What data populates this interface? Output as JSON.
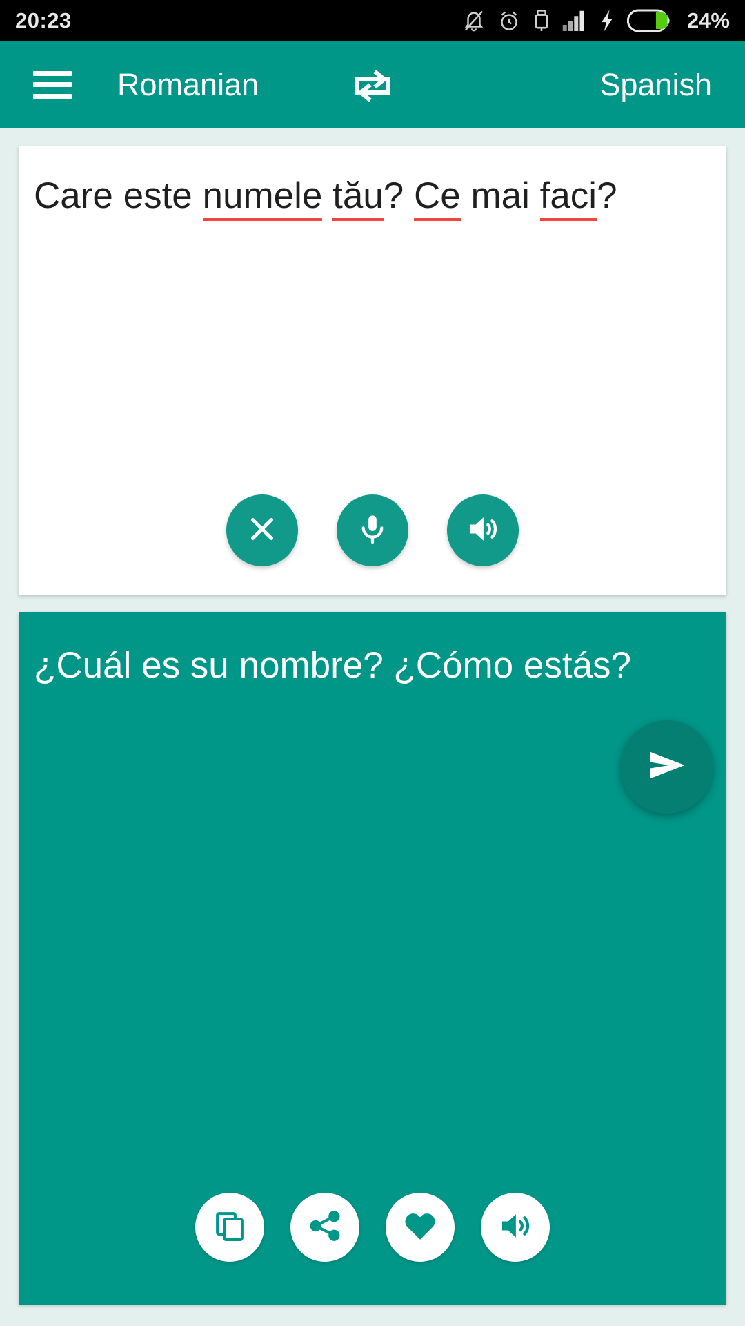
{
  "status_bar": {
    "time": "20:23",
    "battery_percent": "24%",
    "icons": [
      "silent-bell-icon",
      "alarm-clock-icon",
      "usb-lock-icon",
      "signal-bars-icon",
      "charging-bolt-icon",
      "battery-icon"
    ]
  },
  "app_bar": {
    "menu_icon": "hamburger-menu-icon",
    "source_language": "Romanian",
    "swap_icon": "swap-languages-icon",
    "target_language": "Spanish"
  },
  "source_panel": {
    "text_segments": [
      {
        "text": "Care este ",
        "misspelled": false
      },
      {
        "text": "numele",
        "misspelled": true
      },
      {
        "text": " ",
        "misspelled": false
      },
      {
        "text": "tău",
        "misspelled": true
      },
      {
        "text": "? ",
        "misspelled": false
      },
      {
        "text": "Ce",
        "misspelled": true
      },
      {
        "text": " mai ",
        "misspelled": false
      },
      {
        "text": "faci",
        "misspelled": true
      },
      {
        "text": "?",
        "misspelled": false
      }
    ],
    "full_text": "Care este numele tău? Ce mai faci?",
    "actions": [
      {
        "name": "clear-button",
        "icon": "close-x-icon"
      },
      {
        "name": "microphone-button",
        "icon": "microphone-icon"
      },
      {
        "name": "speak-source-button",
        "icon": "speaker-icon"
      }
    ]
  },
  "target_panel": {
    "text": "¿Cuál es su nombre? ¿Cómo estás?",
    "actions": [
      {
        "name": "copy-button",
        "icon": "copy-icon"
      },
      {
        "name": "share-button",
        "icon": "share-icon"
      },
      {
        "name": "favorite-button",
        "icon": "heart-icon"
      },
      {
        "name": "speak-target-button",
        "icon": "speaker-icon"
      }
    ]
  },
  "send_button": {
    "icon": "send-icon"
  },
  "colors": {
    "primary": "#009688",
    "primary_dark": "#057f71",
    "accent_circle": "#11998a",
    "background": "#e4f0ee",
    "spellcheck_underline": "#f4453c",
    "battery_green": "#55cc12"
  }
}
